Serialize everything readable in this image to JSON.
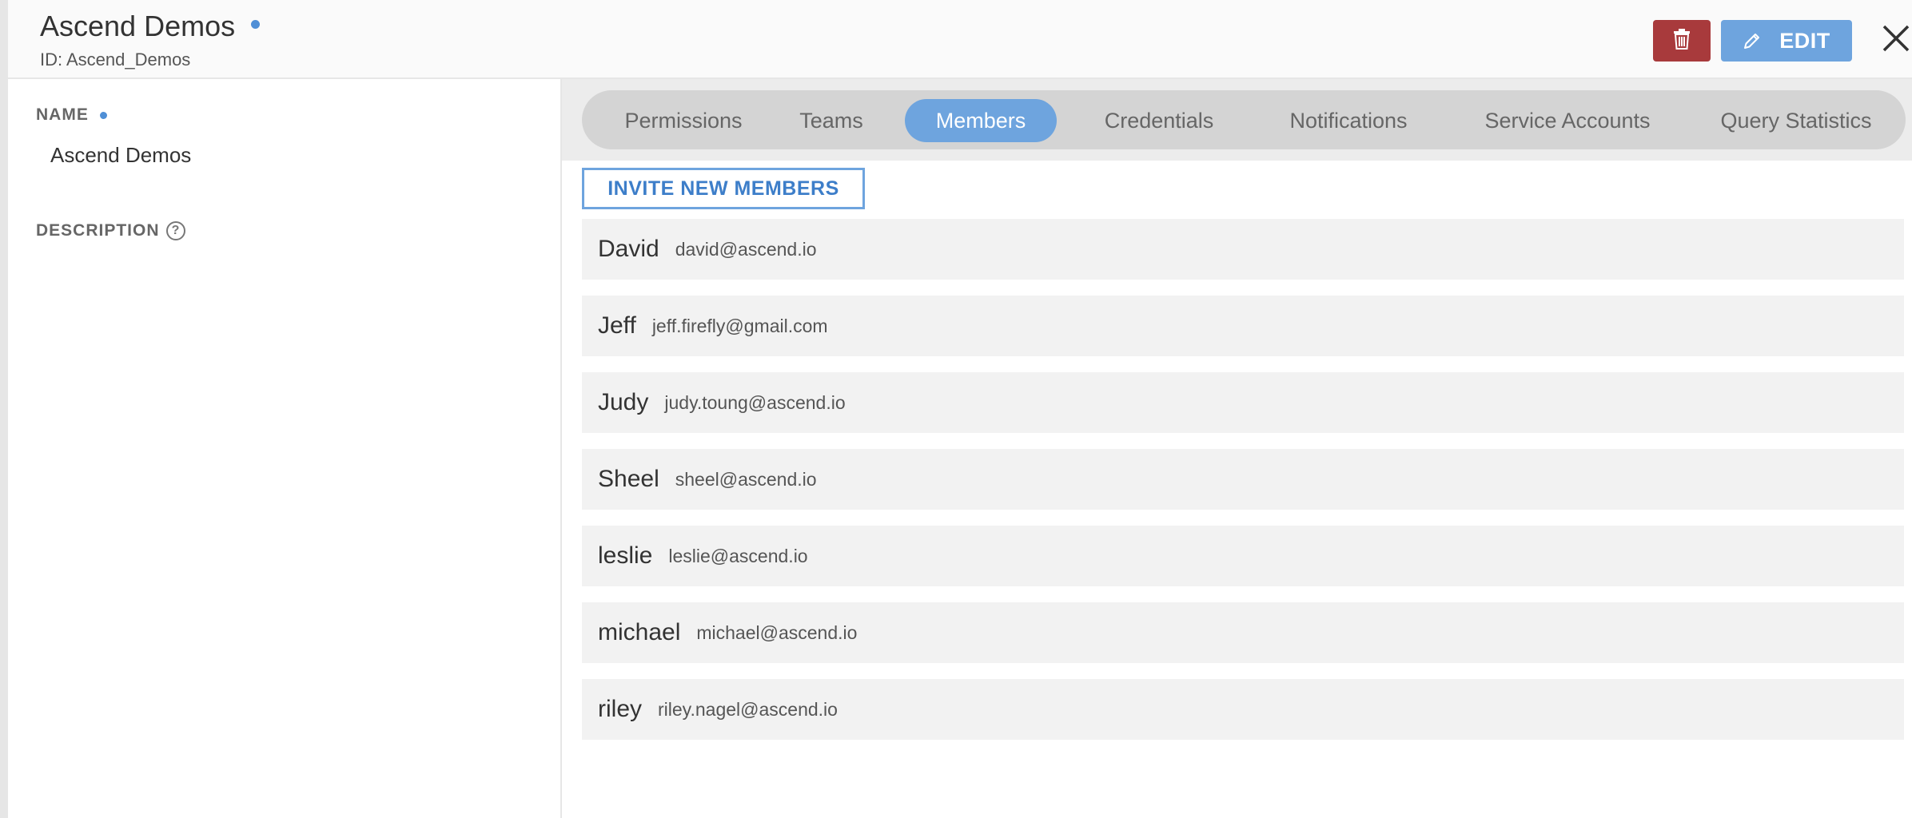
{
  "header": {
    "title": "Ascend Demos",
    "id_text": "ID: Ascend_Demos",
    "edit_label": "EDIT"
  },
  "icons": {
    "delete": "trash-icon",
    "edit": "pencil-icon",
    "close": "close-icon",
    "help": "help-circle-icon"
  },
  "left": {
    "name_label": "NAME",
    "name_value": "Ascend Demos",
    "description_label": "DESCRIPTION",
    "help_glyph": "?"
  },
  "tabs": [
    {
      "label": "Permissions",
      "active": false
    },
    {
      "label": "Teams",
      "active": false
    },
    {
      "label": "Members",
      "active": true
    },
    {
      "label": "Credentials",
      "active": false
    },
    {
      "label": "Notifications",
      "active": false
    },
    {
      "label": "Service Accounts",
      "active": false
    },
    {
      "label": "Query Statistics",
      "active": false
    }
  ],
  "invite_label": "INVITE NEW MEMBERS",
  "members": [
    {
      "name": "David",
      "email": "david@ascend.io"
    },
    {
      "name": "Jeff",
      "email": "jeff.firefly@gmail.com"
    },
    {
      "name": "Judy",
      "email": "judy.toung@ascend.io"
    },
    {
      "name": "Sheel",
      "email": "sheel@ascend.io"
    },
    {
      "name": "leslie",
      "email": "leslie@ascend.io"
    },
    {
      "name": "michael",
      "email": "michael@ascend.io"
    },
    {
      "name": "riley",
      "email": "riley.nagel@ascend.io"
    }
  ],
  "colors": {
    "accent": "#6ea4de",
    "danger": "#a83a3c",
    "status_dot": "#4f8fd6"
  }
}
